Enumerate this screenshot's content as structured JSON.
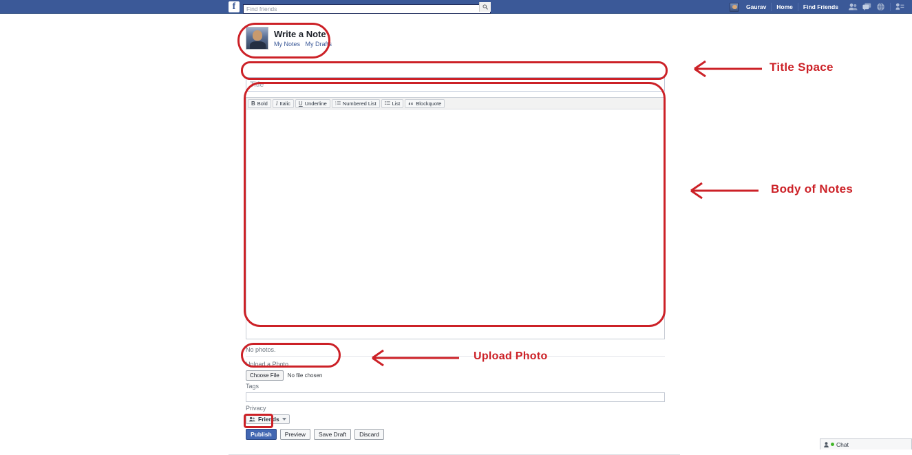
{
  "topbar": {
    "logo_text": "f",
    "logo_name": "facebook-logo",
    "search": {
      "placeholder": "Find friends",
      "value": ""
    },
    "search_icon": "search-icon",
    "user_name": "Gaurav",
    "links": [
      "Home",
      "Find Friends"
    ],
    "icons": [
      "friend-requests-icon",
      "messages-icon",
      "notifications-globe-icon",
      "privacy-shortcuts-icon"
    ],
    "caret_icon": "chevron-down-icon",
    "bg_color": "#3b5998"
  },
  "note": {
    "heading": "Write a Note",
    "sub_links": [
      "My Notes",
      "My Drafts"
    ],
    "avatar_name": "user-avatar"
  },
  "title_field": {
    "placeholder": "Title",
    "value": ""
  },
  "toolbar": {
    "buttons": [
      {
        "glyph": "B",
        "glyph_style": "b",
        "label": "Bold",
        "name": "bold-button"
      },
      {
        "glyph": "I",
        "glyph_style": "i",
        "label": "Italic",
        "name": "italic-button"
      },
      {
        "glyph": "U",
        "glyph_style": "u",
        "label": "Underline",
        "name": "underline-button"
      },
      {
        "glyph": "",
        "glyph_style": "numlist-icon",
        "label": "Numbered List",
        "name": "numbered-list-button"
      },
      {
        "glyph": "",
        "glyph_style": "list-icon",
        "label": "List",
        "name": "bullet-list-button"
      },
      {
        "glyph": "“",
        "glyph_style": "quote",
        "label": "Blockquote",
        "name": "blockquote-button"
      }
    ]
  },
  "body_field": {
    "placeholder": "",
    "value": ""
  },
  "photos": {
    "status": "No photos."
  },
  "upload": {
    "label": "Upload a Photo",
    "choose_button": "Choose File",
    "file_name": "No file chosen"
  },
  "tags": {
    "label": "Tags",
    "value": "",
    "placeholder": ""
  },
  "privacy": {
    "label": "Privacy",
    "value": "Friends",
    "icon": "friends-icon",
    "caret": "chevron-down-icon"
  },
  "actions": [
    {
      "label": "Publish",
      "name": "publish-button",
      "primary": true
    },
    {
      "label": "Preview",
      "name": "preview-button",
      "primary": false
    },
    {
      "label": "Save Draft",
      "name": "save-draft-button",
      "primary": false
    },
    {
      "label": "Discard",
      "name": "discard-button",
      "primary": false
    }
  ],
  "annotations": {
    "color": "#cc2127",
    "title_space": "Title Space",
    "body_of_notes": "Body of Notes",
    "upload_photo": "Upload Photo"
  },
  "chat": {
    "label": "Chat",
    "status_color": "#42b72a",
    "icon": "chat-person-icon"
  }
}
